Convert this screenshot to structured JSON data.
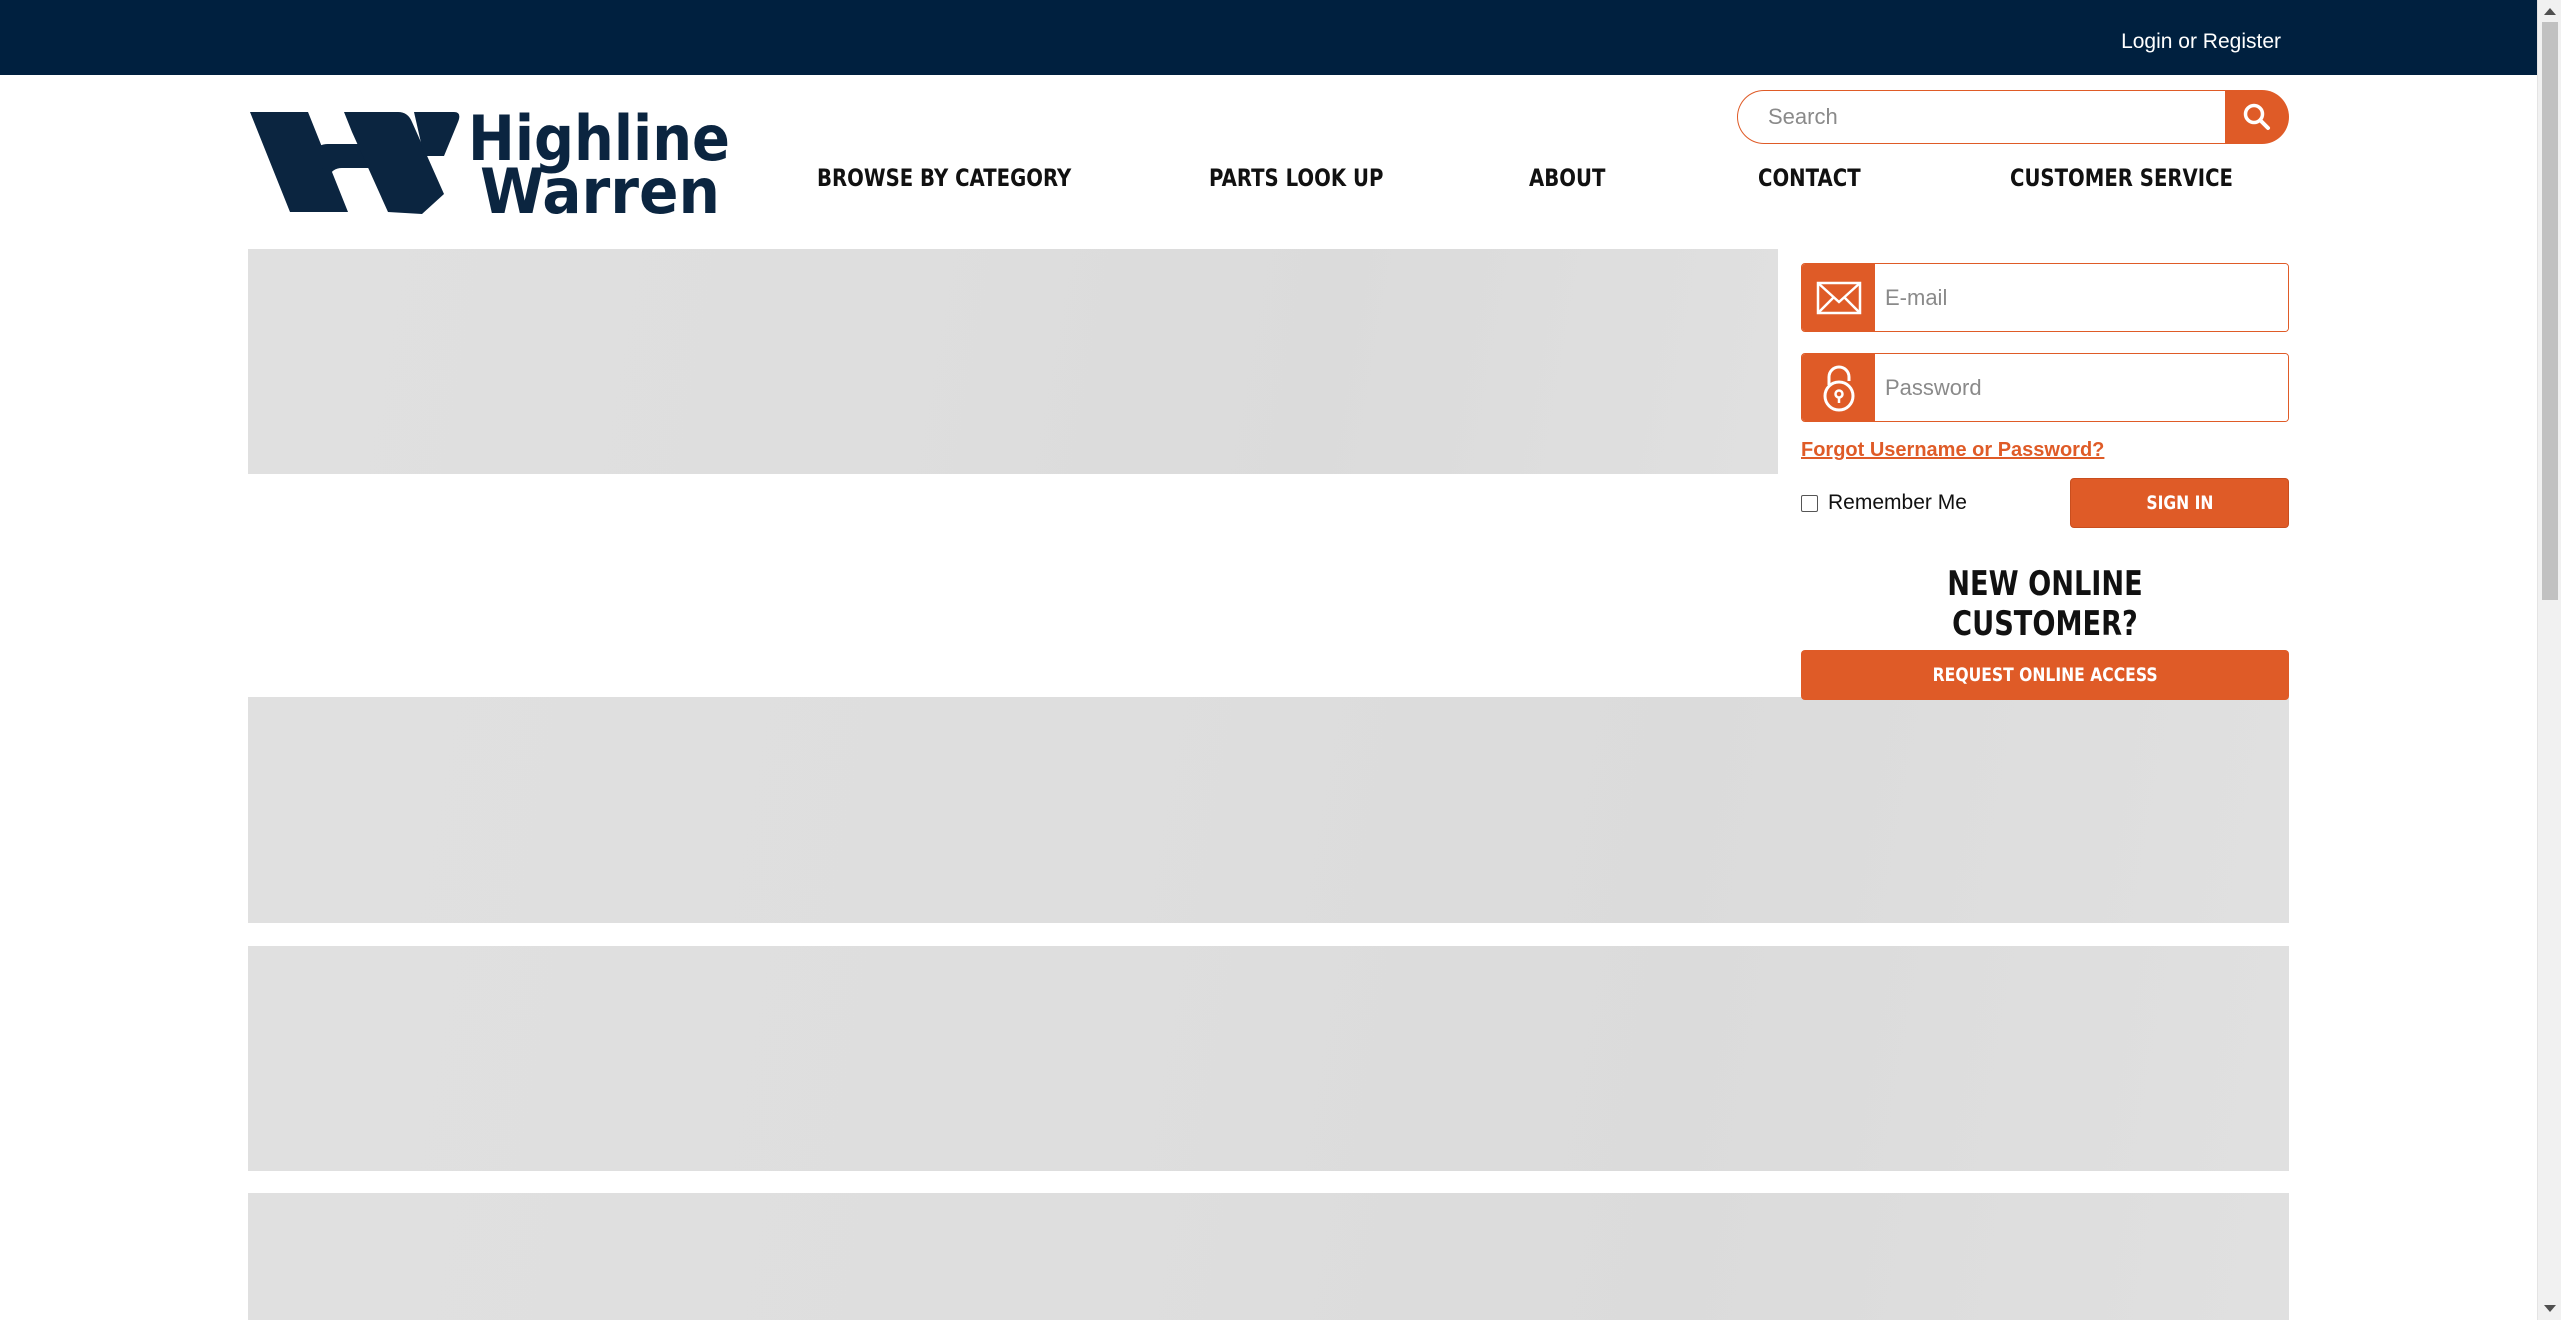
{
  "topbar": {
    "login_register": "Login or Register"
  },
  "logo": {
    "alt": "Highline Warren",
    "line1": "Highline",
    "line2": "Warren",
    "color": "#0b2540"
  },
  "search": {
    "placeholder": "Search",
    "icon": "search-icon"
  },
  "nav": {
    "items": [
      {
        "label": "BROWSE BY CATEGORY"
      },
      {
        "label": "PARTS LOOK UP"
      },
      {
        "label": "ABOUT"
      },
      {
        "label": "CONTACT"
      },
      {
        "label": "CUSTOMER SERVICE"
      }
    ]
  },
  "login": {
    "email_placeholder": "E-mail",
    "email_icon": "envelope-icon",
    "password_placeholder": "Password",
    "password_icon": "lock-icon",
    "forgot_label": "Forgot Username or Password?",
    "remember_label": "Remember Me",
    "remember_checked": false,
    "signin_label": "SIGN IN"
  },
  "new_customer": {
    "heading": "NEW ONLINE CUSTOMER?",
    "request_label": "REQUEST ONLINE ACCESS"
  },
  "colors": {
    "topbar": "#00203f",
    "accent": "#df5b27",
    "placeholder_block": "#dfdfdf"
  }
}
